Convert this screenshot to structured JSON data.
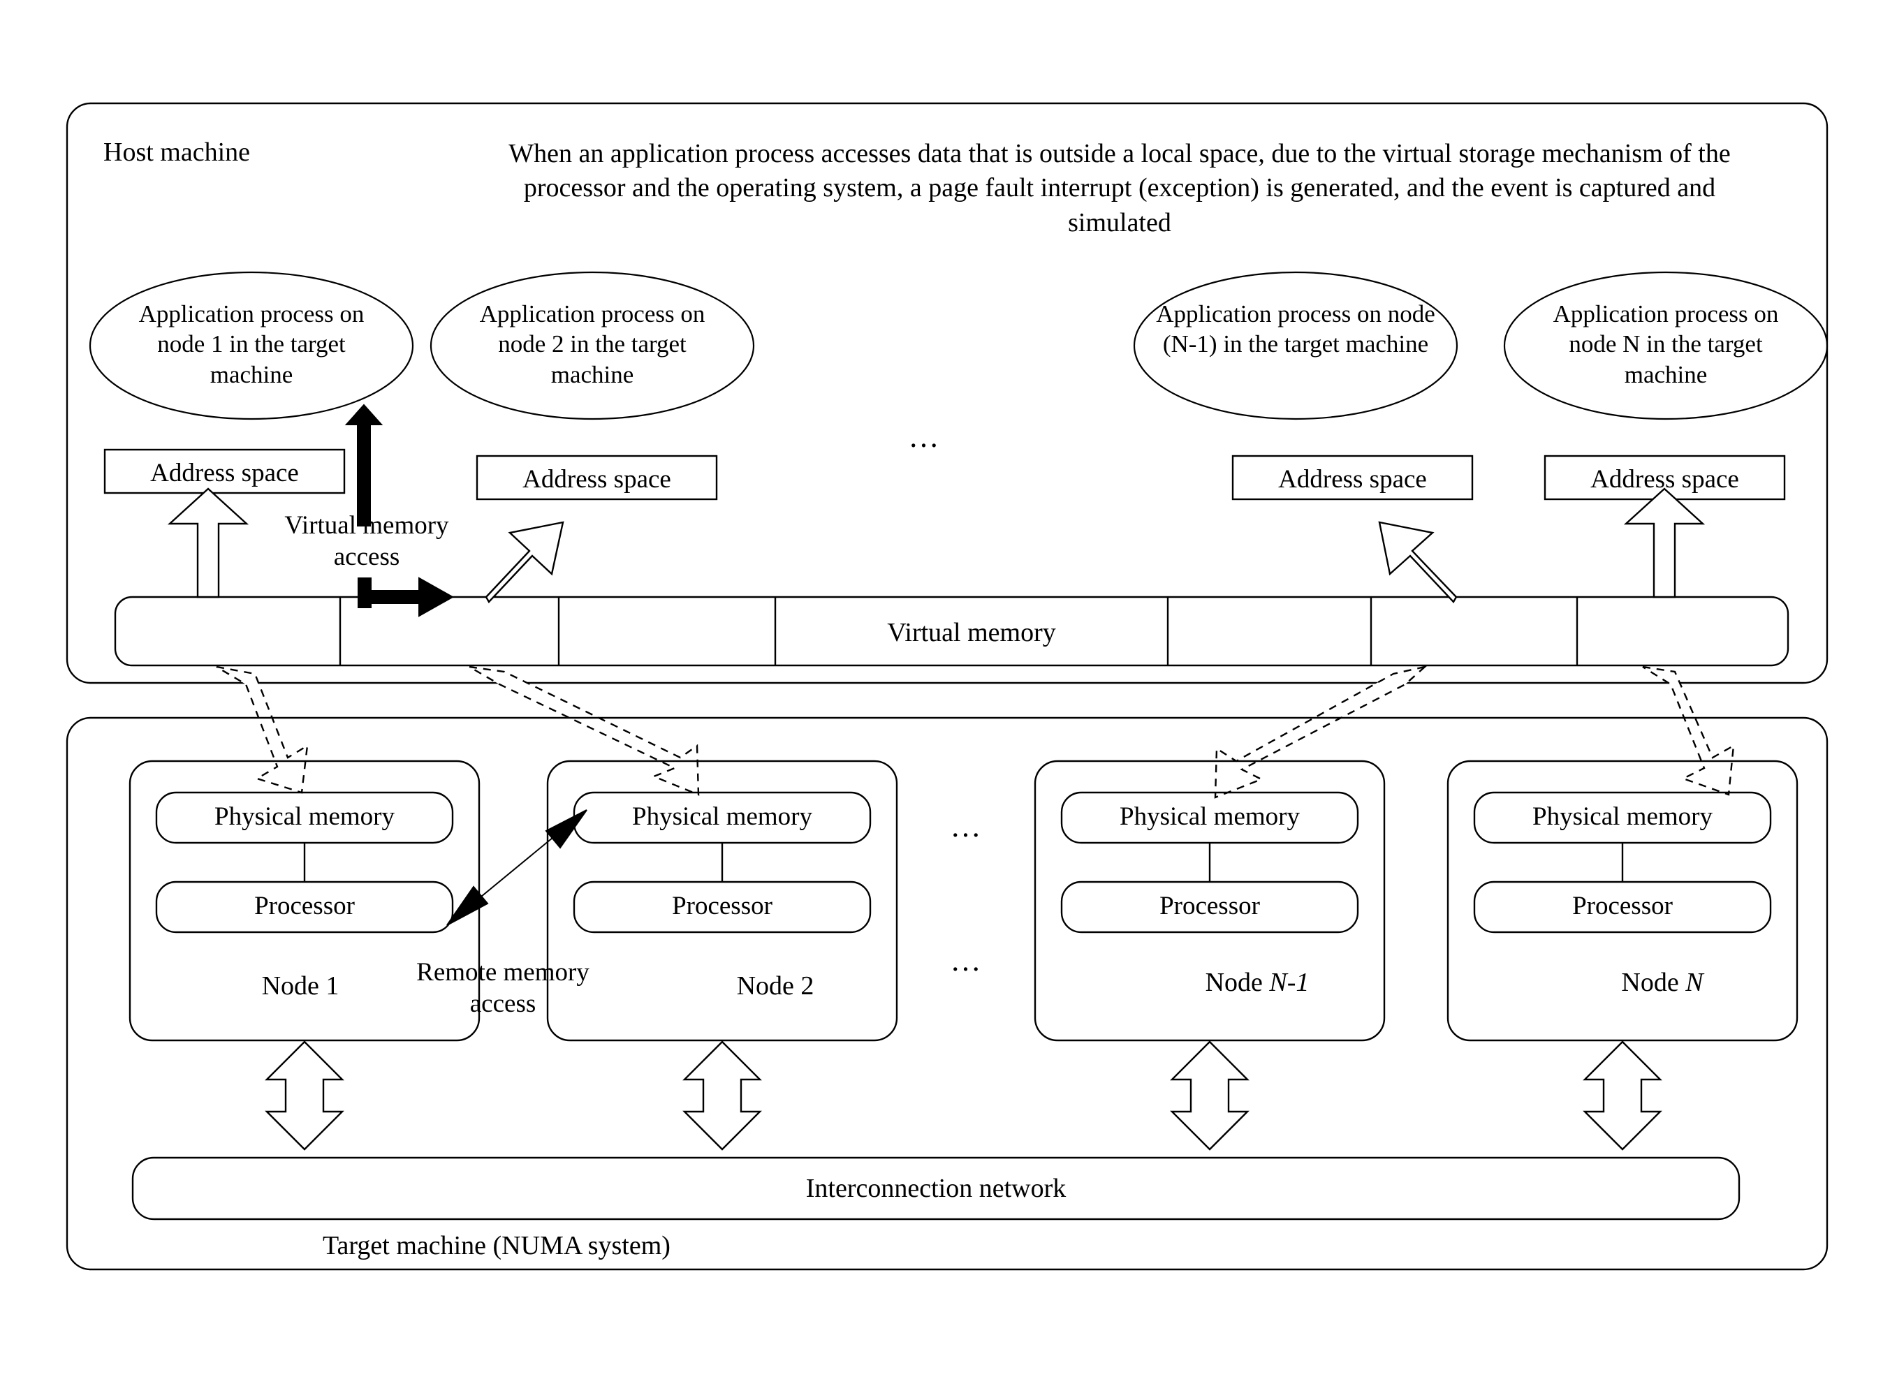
{
  "host": {
    "label": "Host machine",
    "description": "When an application process accesses data that is outside a local space, due to the virtual storage mechanism of the processor and the operating system, a page fault interrupt (exception) is generated, and the event is captured and simulated",
    "processes": [
      {
        "label": "Application process on node 1 in the target machine"
      },
      {
        "label": "Application process on node 2 in the target machine"
      },
      {
        "label": "Application process on node (N-1) in the target machine"
      },
      {
        "label": "Application process on node N in the target machine"
      }
    ],
    "address_spaces": [
      {
        "label": "Address space"
      },
      {
        "label": "Address space"
      },
      {
        "label": "Address space"
      },
      {
        "label": "Address space"
      }
    ],
    "virtual_memory_label": "Virtual memory",
    "virtual_memory_access_label": "Virtual memory\naccess",
    "process_ellipsis": "…"
  },
  "target": {
    "label": "Target machine (NUMA system)",
    "nodes": [
      {
        "name": "Node 1",
        "physical_memory": "Physical memory",
        "processor": "Processor"
      },
      {
        "name": "Node 2",
        "physical_memory": "Physical memory",
        "processor": "Processor"
      },
      {
        "name": "Node N-1",
        "physical_memory": "Physical memory",
        "processor": "Processor"
      },
      {
        "name": "Node N",
        "physical_memory": "Physical memory",
        "processor": "Processor"
      }
    ],
    "remote_memory_access_label": "Remote memory\naccess",
    "interconnection_label": "Interconnection network",
    "node_ellipsis_top": "…",
    "node_ellipsis_bottom": "…"
  },
  "style": {
    "stroke": "#000000",
    "background": "#ffffff"
  }
}
